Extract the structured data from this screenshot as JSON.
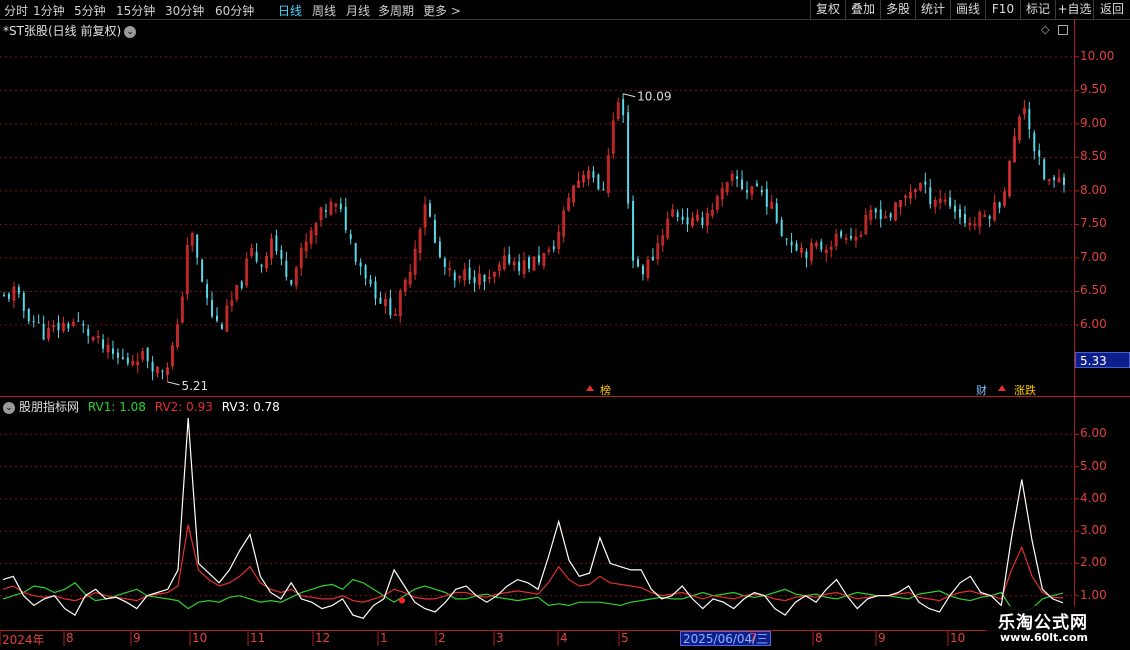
{
  "toolbar": {
    "timeframes": [
      "分时",
      "1分钟",
      "5分钟",
      "15分钟",
      "30分钟",
      "60分钟",
      "日线",
      "周线",
      "月线",
      "多周期",
      "更多 >"
    ],
    "active_timeframe": "日线",
    "buttons": [
      "复权",
      "叠加",
      "多股",
      "统计",
      "画线",
      "F10",
      "标记",
      "+自选",
      "返回"
    ]
  },
  "chart": {
    "title": "*ST张股(日线 前复权)",
    "high_label": "10.09",
    "low_label": "5.21",
    "current_price": "5.33",
    "price_axis": [
      "10.00",
      "9.50",
      "9.00",
      "8.50",
      "8.00",
      "7.50",
      "7.00",
      "6.50",
      "6.00"
    ]
  },
  "annotations": {
    "a1": "榜",
    "a2": "财",
    "a3": "涨跌"
  },
  "indicator": {
    "name": "股朋指标网",
    "rv1_label": "RV1: 1.08",
    "rv2_label": "RV2: 0.93",
    "rv3_label": "RV3: 0.78",
    "axis": [
      "6.00",
      "5.00",
      "4.00",
      "3.00",
      "2.00",
      "1.00"
    ]
  },
  "date_axis": {
    "labels": [
      "2024年",
      "8",
      "9",
      "10",
      "11",
      "12",
      "1",
      "2",
      "3",
      "4",
      "5",
      "6",
      "7",
      "8",
      "9",
      "10"
    ],
    "cursor_date": "2025/06/04/三"
  },
  "watermark": {
    "title": "乐淘公式网",
    "url": "www.60lt.com"
  },
  "colors": {
    "up": "#e03030",
    "down": "#5ad8e8",
    "rv1": "#30d030",
    "rv2": "#e03030",
    "rv3": "#ffffff",
    "grid": "#7a1010",
    "axis_text": "#e04040",
    "active_tab": "#4fd0ff"
  },
  "chart_data": [
    {
      "type": "candlestick",
      "ylim": [
        5.0,
        10.4
      ],
      "y_ticks": [
        6.0,
        6.5,
        7.0,
        7.5,
        8.0,
        8.5,
        9.0,
        9.5,
        10.0
      ],
      "x_labels": [
        "2024年",
        "8",
        "9",
        "10",
        "11",
        "12",
        "1",
        "2",
        "3",
        "4",
        "5",
        "6",
        "7",
        "8",
        "9",
        "10"
      ],
      "max": 10.09,
      "min": 5.21,
      "close_path": [
        6.4,
        6.5,
        6.2,
        6.05,
        5.85,
        5.95,
        6.0,
        6.05,
        5.9,
        5.75,
        5.6,
        5.5,
        5.45,
        5.55,
        5.5,
        5.3,
        5.45,
        6.0,
        7.5,
        6.8,
        6.2,
        5.95,
        6.3,
        6.6,
        7.1,
        6.9,
        7.3,
        6.9,
        6.7,
        7.1,
        7.4,
        7.7,
        7.8,
        7.6,
        7.1,
        6.8,
        6.5,
        6.3,
        6.2,
        6.6,
        7.2,
        7.9,
        7.1,
        6.8,
        6.6,
        6.8,
        6.7,
        6.6,
        6.8,
        7.0,
        6.9,
        6.9,
        7.0,
        7.05,
        7.4,
        8.0,
        8.2,
        8.4,
        7.8,
        8.9,
        9.5,
        7.0,
        6.8,
        7.0,
        7.4,
        7.7,
        7.6,
        7.5,
        7.6,
        7.8,
        8.0,
        8.2,
        8.0,
        8.1,
        7.9,
        7.6,
        7.3,
        7.2,
        7.1,
        7.15,
        7.2,
        7.3,
        7.4,
        7.3,
        7.6,
        7.7,
        7.6,
        7.8,
        8.0,
        8.1,
        7.9,
        7.9,
        7.8,
        7.6,
        7.5,
        7.6,
        7.7,
        7.9,
        8.6,
        9.4,
        8.7,
        8.2,
        8.1,
        8.2
      ]
    },
    {
      "type": "line",
      "ylim": [
        0,
        7
      ],
      "y_ticks": [
        1,
        2,
        3,
        4,
        5,
        6
      ],
      "series": [
        {
          "name": "RV1",
          "last": 1.08,
          "values": [
            0.9,
            1.0,
            1.1,
            1.3,
            1.25,
            1.1,
            1.2,
            1.4,
            1.05,
            0.85,
            0.9,
            1.0,
            1.1,
            1.2,
            1.0,
            0.95,
            0.9,
            0.85,
            0.6,
            0.8,
            0.85,
            0.8,
            0.95,
            1.0,
            0.9,
            0.8,
            0.85,
            0.8,
            0.95,
            1.1,
            1.2,
            1.3,
            1.35,
            1.2,
            1.5,
            1.4,
            1.2,
            1.0,
            0.8,
            1.0,
            1.2,
            1.3,
            1.2,
            1.1,
            0.9,
            0.9,
            1.0,
            1.05,
            0.95,
            0.9,
            0.85,
            0.9,
            0.95,
            0.7,
            0.75,
            0.7,
            0.8,
            0.8,
            0.8,
            0.75,
            0.7,
            0.8,
            0.85,
            0.9,
            0.95,
            0.9,
            0.9,
            1.0,
            1.1,
            1.0,
            1.05,
            1.1,
            1.0,
            0.95,
            1.0,
            1.1,
            1.2,
            1.05,
            1.0,
            1.05,
            0.95,
            0.9,
            1.0,
            1.1,
            1.05,
            1.0,
            1.0,
            0.95,
            0.9,
            1.05,
            1.1,
            1.15,
            1.0,
            0.9,
            0.85,
            0.95,
            1.0,
            1.1,
            0.6,
            0.5,
            0.6,
            0.9,
            1.0,
            1.08
          ]
        },
        {
          "name": "RV2",
          "last": 0.93,
          "values": [
            1.2,
            1.3,
            1.1,
            1.0,
            0.95,
            1.0,
            0.9,
            0.85,
            0.95,
            1.1,
            1.0,
            0.95,
            0.9,
            0.85,
            1.0,
            1.05,
            1.1,
            1.3,
            3.2,
            1.8,
            1.5,
            1.3,
            1.4,
            1.6,
            1.9,
            1.4,
            1.2,
            1.1,
            1.2,
            1.0,
            0.95,
            0.9,
            0.9,
            1.0,
            0.85,
            0.8,
            0.9,
            1.0,
            1.2,
            1.1,
            0.95,
            0.9,
            0.9,
            1.0,
            1.1,
            1.1,
            1.0,
            0.95,
            1.05,
            1.1,
            1.15,
            1.1,
            1.05,
            1.4,
            1.9,
            1.5,
            1.3,
            1.35,
            1.6,
            1.4,
            1.35,
            1.3,
            1.25,
            1.1,
            1.0,
            1.05,
            1.1,
            1.0,
            0.9,
            1.0,
            0.95,
            0.9,
            1.0,
            1.05,
            1.0,
            0.9,
            0.85,
            0.95,
            1.0,
            0.95,
            1.05,
            1.1,
            1.0,
            0.9,
            0.95,
            1.0,
            1.0,
            1.05,
            1.1,
            0.95,
            0.9,
            0.85,
            1.0,
            1.1,
            1.15,
            1.05,
            1.0,
            0.9,
            1.8,
            2.5,
            1.6,
            1.1,
            0.95,
            0.93
          ]
        },
        {
          "name": "RV3",
          "last": 0.78,
          "values": [
            1.5,
            1.6,
            1.0,
            0.7,
            0.9,
            1.0,
            0.6,
            0.4,
            1.0,
            1.2,
            0.9,
            0.95,
            0.8,
            0.6,
            1.0,
            1.1,
            1.2,
            1.8,
            6.5,
            2.0,
            1.7,
            1.4,
            1.8,
            2.4,
            2.9,
            1.6,
            1.1,
            0.9,
            1.4,
            0.9,
            0.8,
            0.6,
            0.7,
            0.9,
            0.4,
            0.3,
            0.7,
            0.9,
            1.8,
            1.3,
            0.8,
            0.6,
            0.5,
            0.8,
            1.2,
            1.3,
            1.0,
            0.8,
            1.0,
            1.3,
            1.5,
            1.4,
            1.2,
            2.2,
            3.3,
            2.1,
            1.6,
            1.7,
            2.8,
            2.0,
            1.9,
            1.8,
            1.8,
            1.2,
            0.9,
            1.0,
            1.3,
            0.9,
            0.6,
            0.9,
            0.8,
            0.6,
            0.9,
            1.1,
            1.0,
            0.6,
            0.4,
            0.8,
            1.0,
            0.8,
            1.2,
            1.5,
            1.0,
            0.6,
            0.9,
            1.0,
            1.0,
            1.1,
            1.3,
            0.8,
            0.6,
            0.5,
            1.0,
            1.4,
            1.6,
            1.1,
            1.0,
            0.7,
            2.8,
            4.6,
            2.7,
            1.2,
            0.9,
            0.78
          ]
        }
      ]
    }
  ]
}
